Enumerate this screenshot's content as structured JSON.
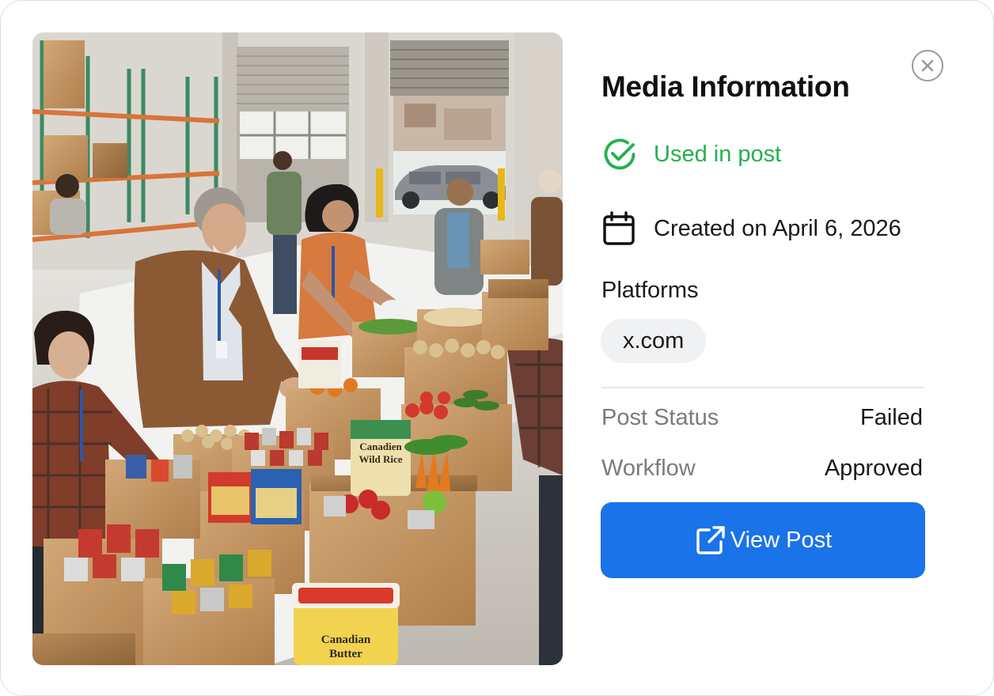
{
  "panel": {
    "title": "Media Information",
    "close_icon": "close-circle-icon"
  },
  "media": {
    "alt": "Food bank volunteers packing boxes of groceries",
    "box_labels": {
      "rice": [
        "Canadien",
        "Wild Rice"
      ],
      "butter": [
        "Canadian",
        "Butter"
      ]
    }
  },
  "usage": {
    "status_label": "Used in post",
    "icon": "check-circle-icon",
    "color": "#22b14c"
  },
  "created": {
    "label": "Created on April 6, 2026",
    "icon": "calendar-icon"
  },
  "platforms": {
    "heading": "Platforms",
    "items": [
      "x.com"
    ]
  },
  "details": {
    "post_status_label": "Post Status",
    "post_status_value": "Failed",
    "workflow_label": "Workflow",
    "workflow_value": "Approved"
  },
  "action": {
    "view_post_label": "View Post",
    "icon": "external-link-icon",
    "color": "#1a73e8"
  }
}
